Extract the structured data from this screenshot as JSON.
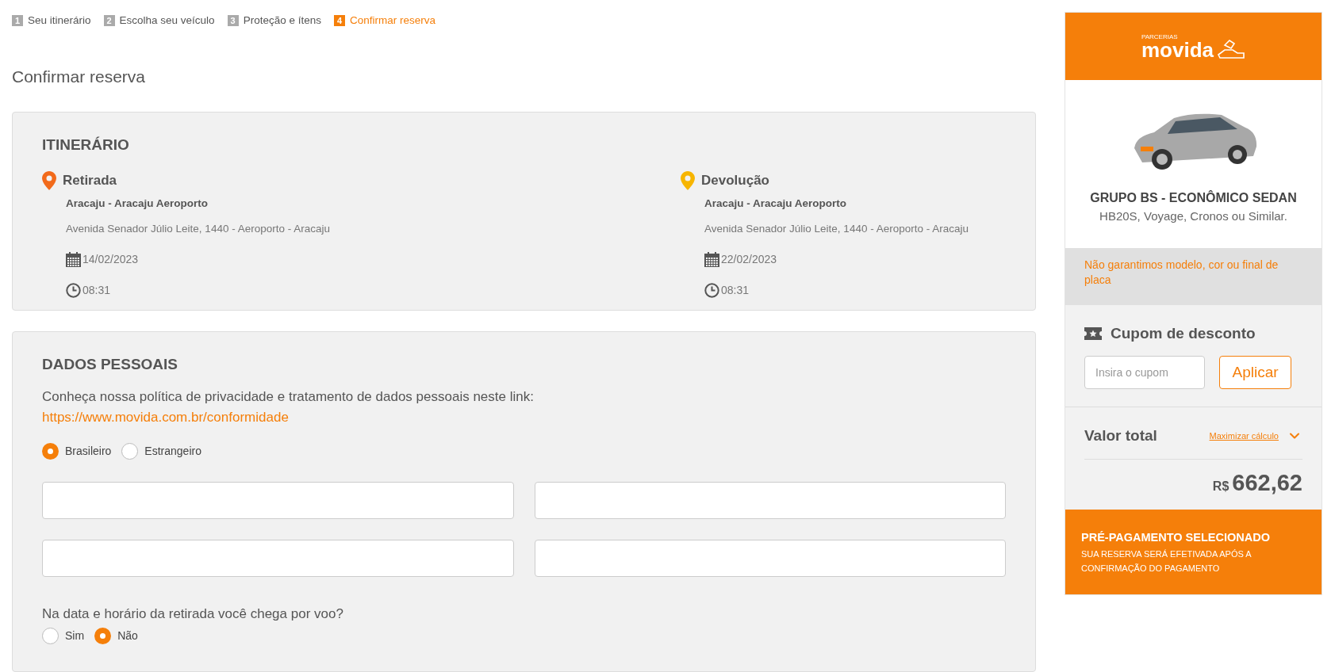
{
  "steps": [
    {
      "number": "1",
      "label": "Seu itinerário",
      "selected": false
    },
    {
      "number": "2",
      "label": "Escolha seu veículo",
      "selected": false
    },
    {
      "number": "3",
      "label": "Proteção e ítens",
      "selected": false
    },
    {
      "number": "4",
      "label": "Confirmar reserva",
      "selected": true
    }
  ],
  "page_title": "Confirmar reserva",
  "itinerary": {
    "title": "ITINERÁRIO",
    "stops": [
      {
        "label": "Retirada",
        "color": "#f26a1b",
        "place": "Aracaju - Aracaju Aeroporto",
        "address": "Avenida Senador Júlio Leite, 1440 - Aeroporto - Aracaju",
        "date": "14/02/2023",
        "time": "08:31"
      },
      {
        "label": "Devolução",
        "color": "#f7b500",
        "place": "Aracaju - Aracaju Aeroporto",
        "address": "Avenida Senador Júlio Leite, 1440 - Aeroporto - Aracaju",
        "date": "22/02/2023",
        "time": "08:31"
      }
    ]
  },
  "personal_data": {
    "title": "DADOS PESSOAIS",
    "privacy_text": "Conheça nossa política de privacidade e tratamento de dados pessoais neste link:",
    "privacy_link": "https://www.movida.com.br/conformidade",
    "nationality": [
      {
        "label": "Brasileiro",
        "selected": true
      },
      {
        "label": "Estrangeiro",
        "selected": false
      }
    ],
    "inputs": [
      {
        "kind": "text"
      },
      {
        "kind": "text"
      },
      {
        "kind": "text"
      },
      {
        "kind": "text"
      }
    ],
    "flight_question": "Na data e horário da retirada você chega por voo?",
    "flight": [
      {
        "label": "Sim",
        "selected": false
      },
      {
        "label": "Não",
        "selected": true
      }
    ]
  },
  "sidebar": {
    "logo": {
      "small": "PARCERIAS",
      "big": "movida"
    },
    "vehicle_group": "GRUPO BS - ECONÔMICO SEDAN",
    "vehicle_models": "HB20S, Voyage, Cronos ou Similar.",
    "notice": "Não garantimos modelo, cor ou final de placa",
    "coupon": {
      "title": "Cupom de desconto",
      "placeholder": "Insira o cupom",
      "button": "Aplicar"
    },
    "total": {
      "label": "Valor total",
      "link": "Maximizar cálculo",
      "currency": "R$",
      "amount": "662,62"
    },
    "payment": {
      "title": "PRÉ-PAGAMENTO SELECIONADO",
      "text": "SUA RESERVA SERÁ EFETIVADA APÓS A CONFIRMAÇÃO DO PAGAMENTO"
    }
  }
}
